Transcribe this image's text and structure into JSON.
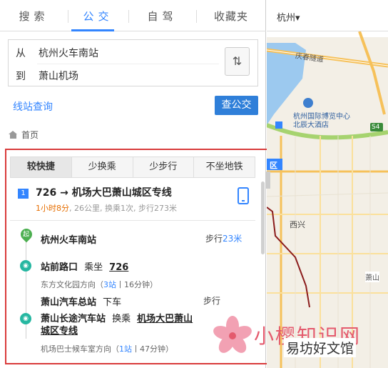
{
  "tabs": [
    {
      "label": "搜索"
    },
    {
      "label": "公交"
    },
    {
      "label": "自驾"
    },
    {
      "label": "收藏夹"
    }
  ],
  "city": "杭州▾",
  "form": {
    "from_label": "从",
    "from_value": "杭州火车南站",
    "to_label": "到",
    "to_value": "萧山机场",
    "swap_icon": "⇅"
  },
  "station_query": "线站查询",
  "check_bus": "查公交",
  "breadcrumb": "首页",
  "options": [
    "较快捷",
    "少换乘",
    "少步行",
    "不坐地铁"
  ],
  "route": {
    "index": "1",
    "title": "726 → 机场大巴萧山城区专线",
    "time": "1小时8分",
    "meta": ", 26公里, 换乘1次, 步行273米"
  },
  "steps": {
    "start": {
      "icon": "起",
      "title": "杭州火车南站",
      "walk_label": "步行",
      "walk_value": "23米"
    },
    "s1": {
      "title": "站前路口",
      "action": "乘坐",
      "line": "726",
      "dir": "东方文化园方向（",
      "stops": "3站",
      "mins": "丨16分钟）"
    },
    "s2": {
      "title": "萧山汽车总站",
      "action": "下车",
      "walk": "步行"
    },
    "s3": {
      "title": "萧山长途汽车站",
      "action": "换乘",
      "line": "机场大巴萧山城区专线",
      "dir": "机场巴士候车室方向（",
      "stops": "1站",
      "mins": "丨47分钟）"
    }
  },
  "map_labels": {
    "road1": "庆春隧道",
    "poi": "杭州国际博览中心北辰大酒店",
    "badge": "S4",
    "district": "区",
    "xixing": "西兴",
    "xiaoshan": "萧山"
  },
  "watermark": {
    "title": "小樱知识网",
    "sub": "易坊好文馆"
  }
}
